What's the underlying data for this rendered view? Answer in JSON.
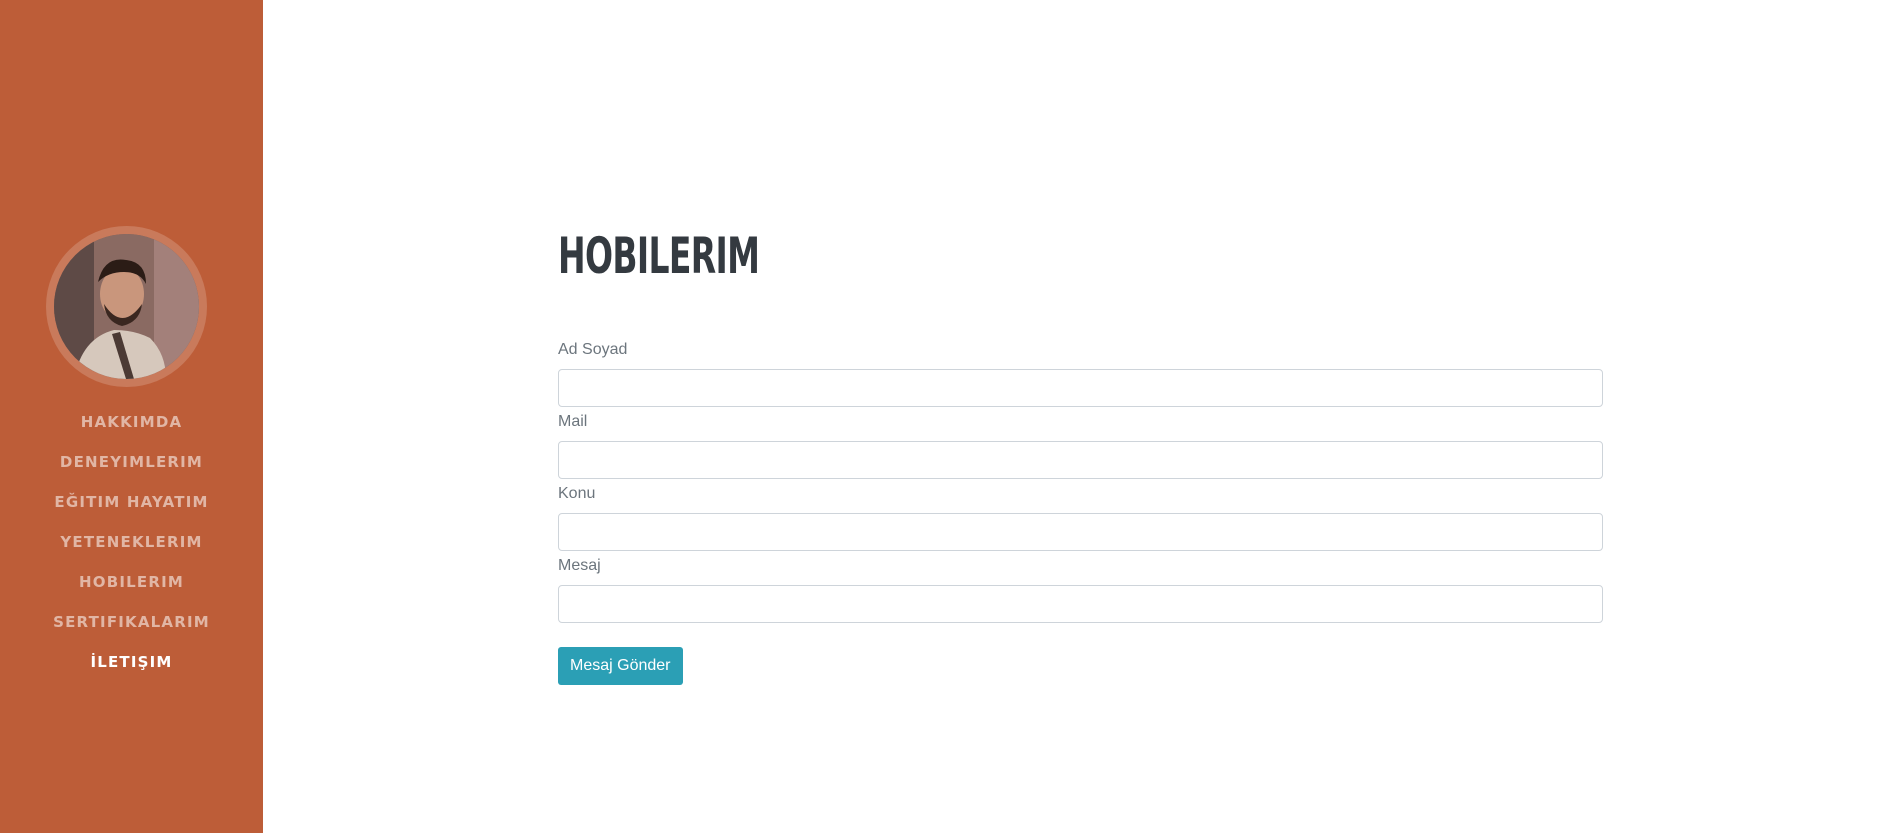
{
  "sidebar": {
    "avatar_alt": "profile photo",
    "nav": [
      {
        "label": "HAKKIMDA",
        "active": false
      },
      {
        "label": "DENEYIMLERIM",
        "active": false
      },
      {
        "label": "EĞITIM HAYATIM",
        "active": false
      },
      {
        "label": "YETENEKLERIM",
        "active": false
      },
      {
        "label": "HOBILERIM",
        "active": false
      },
      {
        "label": "SERTIFIKALARIM",
        "active": false
      },
      {
        "label": "İLETIŞIM",
        "active": true
      }
    ]
  },
  "main": {
    "title": "HOBILERIM",
    "form": {
      "fields": [
        {
          "label": "Ad Soyad",
          "value": "",
          "placeholder": ""
        },
        {
          "label": "Mail",
          "value": "",
          "placeholder": ""
        },
        {
          "label": "Konu",
          "value": "",
          "placeholder": ""
        },
        {
          "label": "Mesaj",
          "value": "",
          "placeholder": ""
        }
      ],
      "submit_label": "Mesaj Gönder"
    }
  },
  "colors": {
    "sidebar_bg": "#bd5d38",
    "button_bg": "#2b9fb5",
    "title": "#343a40"
  }
}
